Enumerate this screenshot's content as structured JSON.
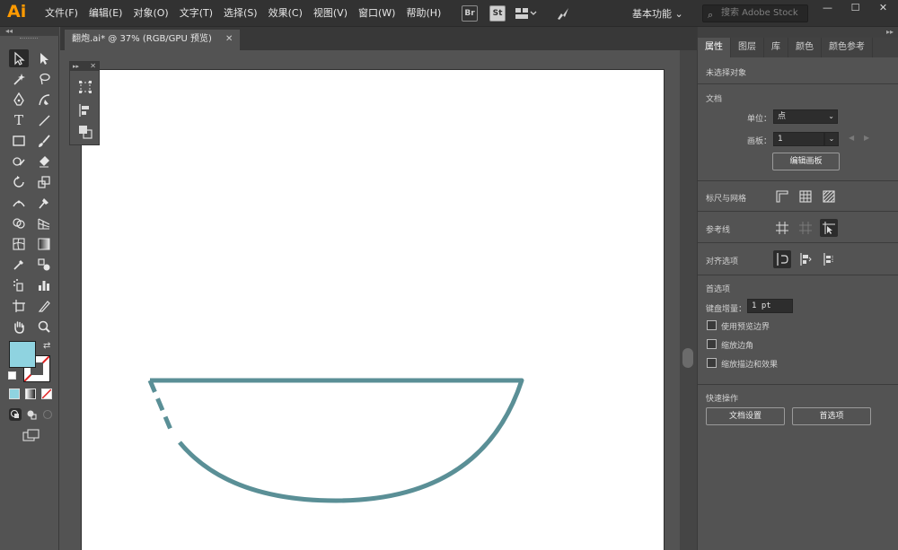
{
  "app": {
    "logo": "Ai"
  },
  "menubar": {
    "menus": [
      "文件(F)",
      "编辑(E)",
      "对象(O)",
      "文字(T)",
      "选择(S)",
      "效果(C)",
      "视图(V)",
      "窗口(W)",
      "帮助(H)"
    ],
    "br_label": "Br",
    "st_label": "St",
    "workspace": "基本功能 ⌄",
    "search_placeholder": "搜索 Adobe Stock",
    "minimize": "—",
    "maximize": "☐",
    "close": "✕"
  },
  "document": {
    "tab_title": "翻炮.ai* @ 37% (RGB/GPU 预览)",
    "tab_close": "✕"
  },
  "floating_panel": {
    "collapse": "▸▸",
    "close": "✕"
  },
  "toolbar": {
    "collapse": "◂◂"
  },
  "right_panel": {
    "collapse": "▸▸",
    "tabs": [
      "属性",
      "图层",
      "库",
      "颜色",
      "颜色参考"
    ],
    "active_tab": "属性",
    "no_selection": "未选择对象",
    "document_section": {
      "title": "文档",
      "unit_label": "单位：",
      "unit_value": "点",
      "artboard_label": "画板：",
      "artboard_value": "1",
      "edit_artboard_button": "编辑画板"
    },
    "rulers_grid": {
      "label": "标尺与网格"
    },
    "guides": {
      "label": "参考线"
    },
    "snap_options": {
      "label": "对齐选项"
    },
    "preferences": {
      "title": "首选项",
      "keyboard_increment_label": "键盘增量：",
      "keyboard_increment_value": "1 pt",
      "checkboxes": [
        "使用预览边界",
        "缩放边角",
        "缩放描边和效果"
      ]
    },
    "quick_actions": {
      "title": "快速操作",
      "document_setup": "文档设置",
      "preferences": "首选项"
    }
  },
  "colors": {
    "fill_swatch": "#8fd3e0",
    "stroke_curve": "#5a8f96",
    "brand": "#ff9a00"
  }
}
